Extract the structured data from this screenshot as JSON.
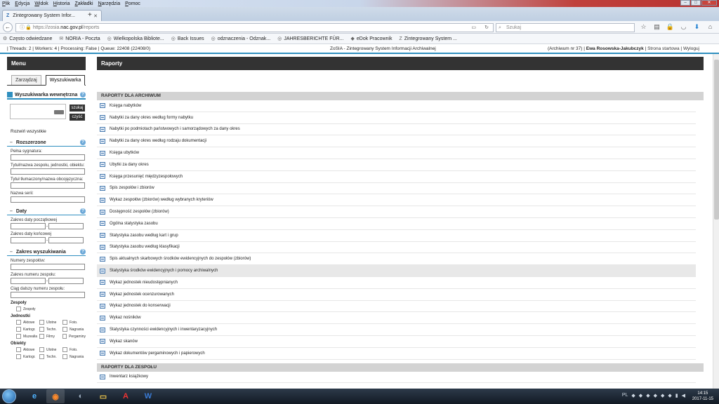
{
  "browser": {
    "menu": [
      "Plik",
      "Edycja",
      "Widok",
      "Historia",
      "Zakładki",
      "Narzędzia",
      "Pomoc"
    ],
    "tab_title": "Zintegrowany System Infor...",
    "url_prefix": "https://zosia.",
    "url_domain": "nac.gov.pl",
    "url_path": "/reports",
    "search_placeholder": "Szukaj",
    "bookmarks": [
      "Często odwiedzane",
      "NORIA - Poczta",
      "Wielkopolska Bibliote...",
      "Back Issues",
      "odznaczenia - Odznak...",
      "JAHRESBERICHTE FÜR...",
      "eDok Pracownik",
      "Zintegrowany System ..."
    ]
  },
  "status": {
    "left": "| Threads: 2 | Workers: 4 | Processing: False | Queue: 22408 (22408/0)",
    "center": "ZoSIA - Zintegrowany System Informacji Archiwalnej",
    "archive": "(Archiwum nr 37)",
    "user": "Ewa Rosowska-Jakubczyk",
    "home_link": "Strona startowa",
    "logout_link": "Wyloguj"
  },
  "sidebar": {
    "title": "Menu",
    "tabs": [
      "Zarządzaj",
      "Wyszukiwarka"
    ],
    "search_section": "Wyszukiwarka wewnętrzna",
    "search_btn": "szukaj",
    "clear_btn": "czyść",
    "expand_all": "Rozwiń wszystkie",
    "advanced": {
      "title": "Rozszerzone",
      "fields": [
        "Pełna sygnatura:",
        "Tytuł/nazwa zespołu, jednostki, obiektu:",
        "Tytuł tłumaczony/nazwa obcojęzyczna:",
        "Nazwa serii:"
      ]
    },
    "dates": {
      "title": "Daty",
      "start": "Zakres daty początkowej",
      "end": "Zakres daty końcowej"
    },
    "scope": {
      "title": "Zakres wyszukiwania",
      "numbers": "Numery zespołów:",
      "number_range": "Zakres numeru zespołu:",
      "number_suffix": "Ciąg dalszy numeru zespołu:",
      "group_fonds": "Zespoły",
      "fonds_options": [
        "Zespoły"
      ],
      "group_units": "Jednostki",
      "units_options": [
        "Aktowe",
        "Ulotne",
        "Foto.",
        "Kartogr.",
        "Techn.",
        "Nagrania",
        "Muzealia",
        "Filmy",
        "Pergaminy"
      ],
      "group_objects": "Obiekty",
      "objects_options": [
        "Aktowe",
        "Ulotne",
        "Foto.",
        "Kartogr.",
        "Techn.",
        "Nagrania"
      ]
    }
  },
  "main": {
    "title": "Raporty",
    "section_archive": "RAPORTY DLA ARCHIWUM",
    "reports": [
      "Księga nabytków",
      "Nabytki za dany okres według formy nabytku",
      "Nabytki po podmiotach państwowych i samorządowych za dany okres",
      "Nabytki za dany okres według rodzaju dokumentacji",
      "Księga ubytków",
      "Ubytki za dany okres",
      "Księga przesunięć międzyzespołowych",
      "Spis zespołów i zbiorów",
      "Wykaz zespołów (zbiorów) według wybranych kryteriów",
      "Dostępność zespołów (zbiorów)",
      "Ogólna statystyka zasobu",
      "Statystyka zasobu według kart i grup",
      "Statystyka zasobu według klasyfikacji",
      "Spis aktualnych skarbowych środków ewidencyjnych do zespołów (zbiorów)",
      "Statystyka środków ewidencyjnych i pomocy archiwalnych",
      "Wykaz jednostek nieudostępnianych",
      "Wykaz jednostek ocenzurowanych",
      "Wykaz jednostek do konserwacji",
      "Wykaz nośników",
      "Statystyka czynności ewidencyjnych i inwentaryzacyjnych",
      "Wykaz skanów",
      "Wykaz dokumentów pergaminowych i papierowych"
    ],
    "highlighted_index": 14,
    "section_fonds": "RAPORTY DLA ZESPOŁU",
    "fonds_reports": [
      "Inwentarz książkowy"
    ]
  },
  "taskbar": {
    "lang": "PL",
    "time": "14:15",
    "date": "2017-11-15"
  }
}
